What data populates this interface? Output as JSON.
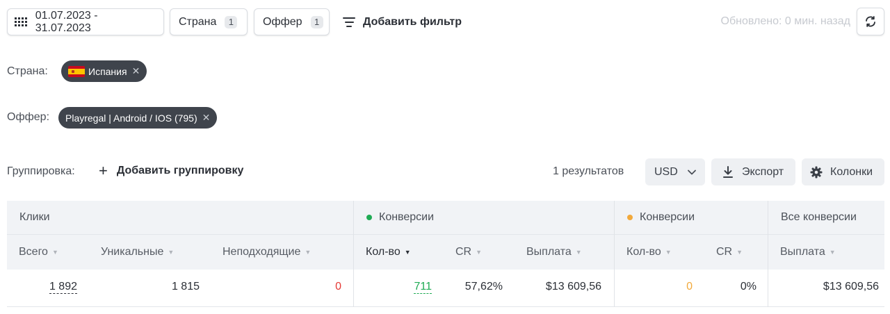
{
  "toolbar": {
    "date_range": "01.07.2023 - 31.07.2023",
    "country_filter": {
      "label": "Страна",
      "count": "1"
    },
    "offer_filter": {
      "label": "Оффер",
      "count": "1"
    },
    "add_filter_label": "Добавить фильтр",
    "updated_text": "Обновлено: 0 мин. назад"
  },
  "active_filters": {
    "country": {
      "label": "Страна:",
      "chip": "Испания",
      "flag": "es"
    },
    "offer": {
      "label": "Оффер:",
      "chip": "Playregal | Android / IOS (795)"
    }
  },
  "grouping": {
    "label": "Группировка:",
    "add_label": "Добавить группировку",
    "results": "1 результатов",
    "currency": "USD",
    "export_label": "Экспорт",
    "columns_label": "Колонки"
  },
  "table": {
    "groups": [
      {
        "label": "Клики"
      },
      {
        "label": "Конверсии",
        "dot_color": "#1fab54"
      },
      {
        "label": "Конверсии",
        "dot_color": "#f2a93b"
      },
      {
        "label": "Все конверсии"
      }
    ],
    "columns": [
      "Всего",
      "Уникальные",
      "Неподходящие",
      "Кол-во",
      "CR",
      "Выплата",
      "Кол-во",
      "CR",
      "Выплата"
    ],
    "row": {
      "total": "1 892",
      "unique": "1 815",
      "unsuitable": "0",
      "conv_green_count": "711",
      "conv_green_cr": "57,62%",
      "conv_green_payout": "$13 609,56",
      "conv_orange_count": "0",
      "conv_orange_cr": "0%",
      "all_payout": "$13 609,56"
    }
  },
  "colors": {
    "red": "#e53935",
    "green": "#1fab54",
    "orange": "#f2a93b"
  }
}
